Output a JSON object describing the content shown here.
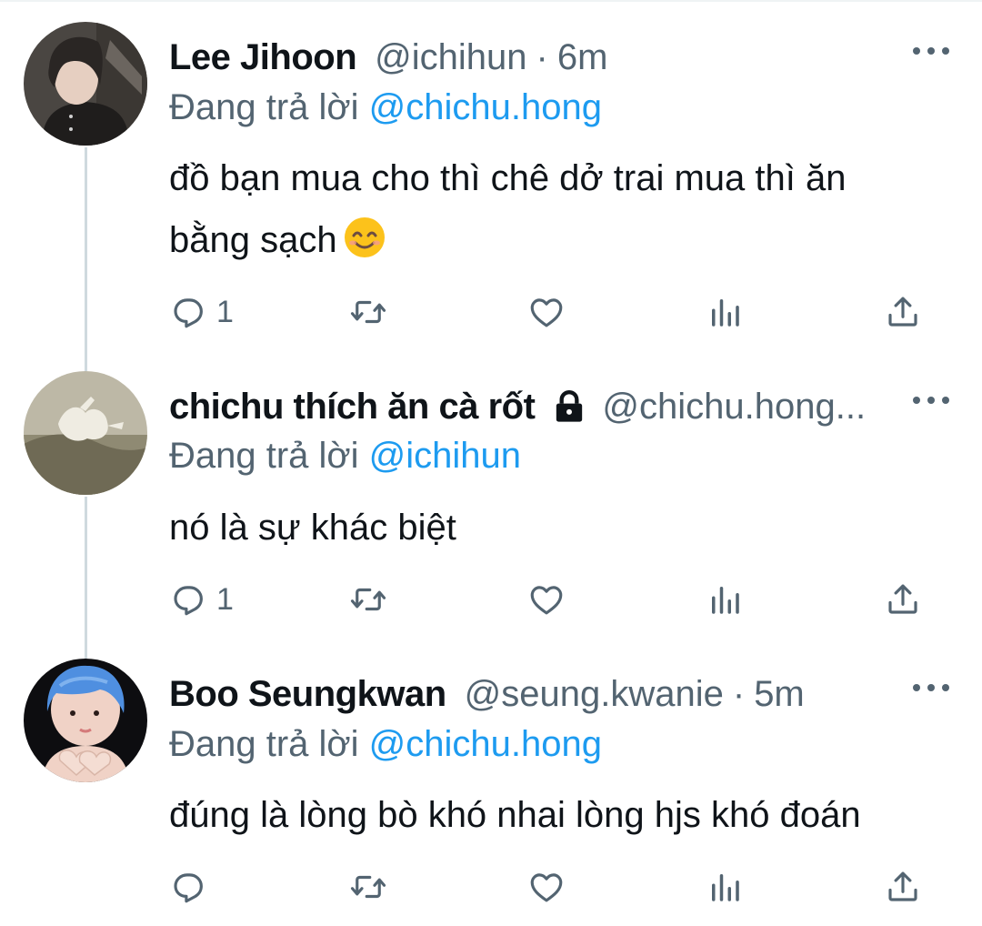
{
  "reply_prefix": "Đang trả lời",
  "tweets": [
    {
      "name": "Lee Jihoon",
      "handle": "@ichihun",
      "dot": "·",
      "time": "6m",
      "reply_to": "@chichu.hong",
      "text_line1": "đồ bạn mua cho thì chê dở trai mua thì ăn",
      "text_line2": "bằng sạch",
      "emoji": "smiling-face-emoji",
      "reply_count": "1",
      "protected": false
    },
    {
      "name": "chichu thích ăn cà rốt",
      "handle": "@chichu.hong...",
      "reply_to": "@ichihun",
      "text_line1": "nó là sự khác biệt",
      "reply_count": "1",
      "protected": true
    },
    {
      "name": "Boo Seungkwan",
      "handle": "@seung.kwanie",
      "dot": "·",
      "time": "5m",
      "reply_to": "@chichu.hong",
      "text_line1": "đúng là lòng bò khó nhai lòng hjs khó đoán",
      "reply_count": "",
      "protected": false
    }
  ],
  "icons": {
    "reply": "reply-icon",
    "retweet": "retweet-icon",
    "like": "heart-icon",
    "views": "views-icon",
    "share": "share-icon",
    "more": "more-icon",
    "lock": "lock-icon"
  },
  "colors": {
    "text": "#0f1419",
    "secondary": "#536471",
    "mention": "#1d9bf0",
    "thread_line": "#cfd9de"
  }
}
